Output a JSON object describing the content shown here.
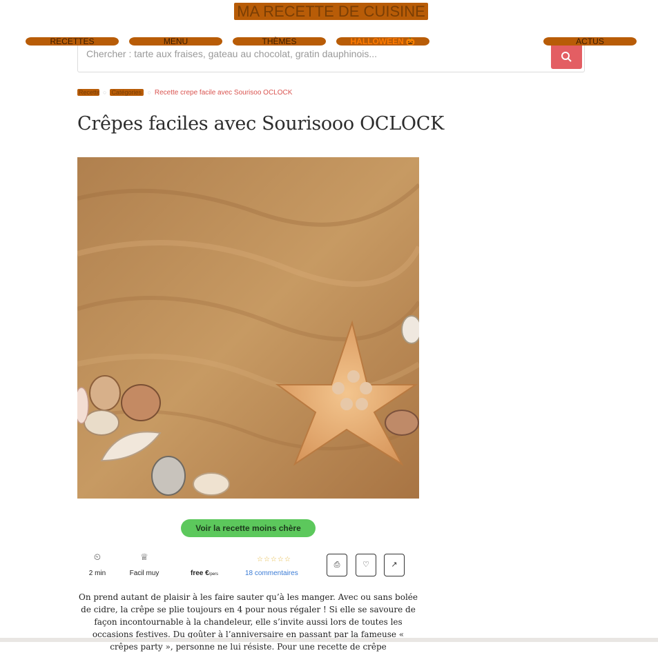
{
  "site": {
    "brand": "MA RECETTE DE CUISINE"
  },
  "nav": {
    "items": [
      {
        "label": "Recettes"
      },
      {
        "label": "Menu"
      },
      {
        "label": "Thèmes"
      },
      {
        "label": "Halloween",
        "icon": "pumpkin-icon"
      },
      {
        "label": "Actus"
      }
    ]
  },
  "search": {
    "placeholder": "Chercher : tarte aux fraises, gateau au chocolat, gratin dauphinois..."
  },
  "breadcrumb": {
    "home": "Recettes",
    "category": "Catégories",
    "current": "Recette crepe facile avec Sourisoo OCLOCK"
  },
  "article": {
    "title": "Crêpes faciles avec Sourisooo OCLOCK",
    "image_alt": "Sable, étoile de mer et coquillages",
    "cta_label": "Voir la recette moins chère",
    "meta": {
      "time": "2 min",
      "difficulty": "Facil muy",
      "price": "free €",
      "price_unit": "/pers",
      "rating_stars": "☆☆☆☆☆",
      "comments": "18 commentaires"
    },
    "description": "On prend autant de plaisir à les faire sauter qu’à les manger. Avec ou sans bolée de cidre, la crêpe se plie toujours en 4 pour nous régaler ! Si elle se savoure de façon incontournable à la chandeleur, elle s’invite aussi lors de toutes les occasions festives. Du goûter à l’anniversaire en passant par la fameuse « crêpes party », personne ne lui résiste. Pour une recette de crêpe"
  },
  "icons": {
    "time": "clock-icon",
    "difficulty": "chef-hat-icon",
    "share_buttons": [
      "print-icon",
      "heart-icon",
      "share-icon"
    ]
  },
  "colors": {
    "nav": "#b85c07",
    "halloween": "#ff7a00",
    "search_button": "#e35e63",
    "cta": "#5cc85c",
    "link": "#3a7bd5"
  }
}
